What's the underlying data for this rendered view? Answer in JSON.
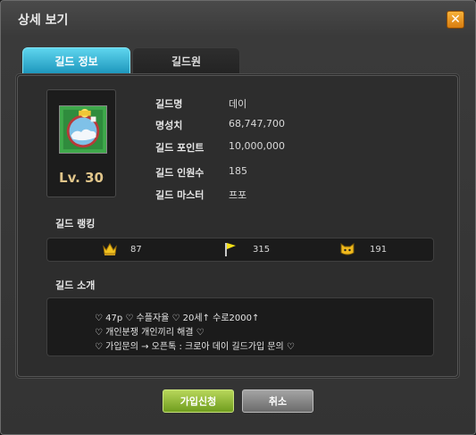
{
  "window": {
    "title": "상세 보기",
    "close_icon": "close-icon"
  },
  "tabs": [
    {
      "label": "길드 정보",
      "active": true
    },
    {
      "label": "길드원",
      "active": false
    }
  ],
  "guild": {
    "level": "Lv. 30",
    "fields": [
      {
        "label": "길드명",
        "value": "데이"
      },
      {
        "label": "명성치",
        "value": "68,747,700"
      },
      {
        "label": "길드 포인트",
        "value": "10,000,000"
      },
      {
        "label": "길드 인원수",
        "value": "185"
      },
      {
        "label": "길드 마스터",
        "value": "프포"
      }
    ]
  },
  "ranking": {
    "label": "길드 랭킹",
    "items": [
      {
        "icon": "crown-icon",
        "value": "87"
      },
      {
        "icon": "flag-icon",
        "value": "315"
      },
      {
        "icon": "cat-mask-icon",
        "value": "191"
      }
    ]
  },
  "intro": {
    "label": "길드 소개",
    "lines": [
      "♡ 47p ♡ 수플자율 ♡ 20세↑ 수로2000↑",
      "♡ 개인분쟁 개인끼리 해결 ♡",
      "♡ 가입문의 → 오픈톡 : 크로아 데이 길드가입 문의 ♡"
    ]
  },
  "buttons": {
    "join": "가입신청",
    "cancel": "취소"
  },
  "colors": {
    "tab_active": "#1e97bd",
    "join_button": "#6f9d1e",
    "cancel_button": "#6b6b6b",
    "close_button": "#d87d10"
  }
}
